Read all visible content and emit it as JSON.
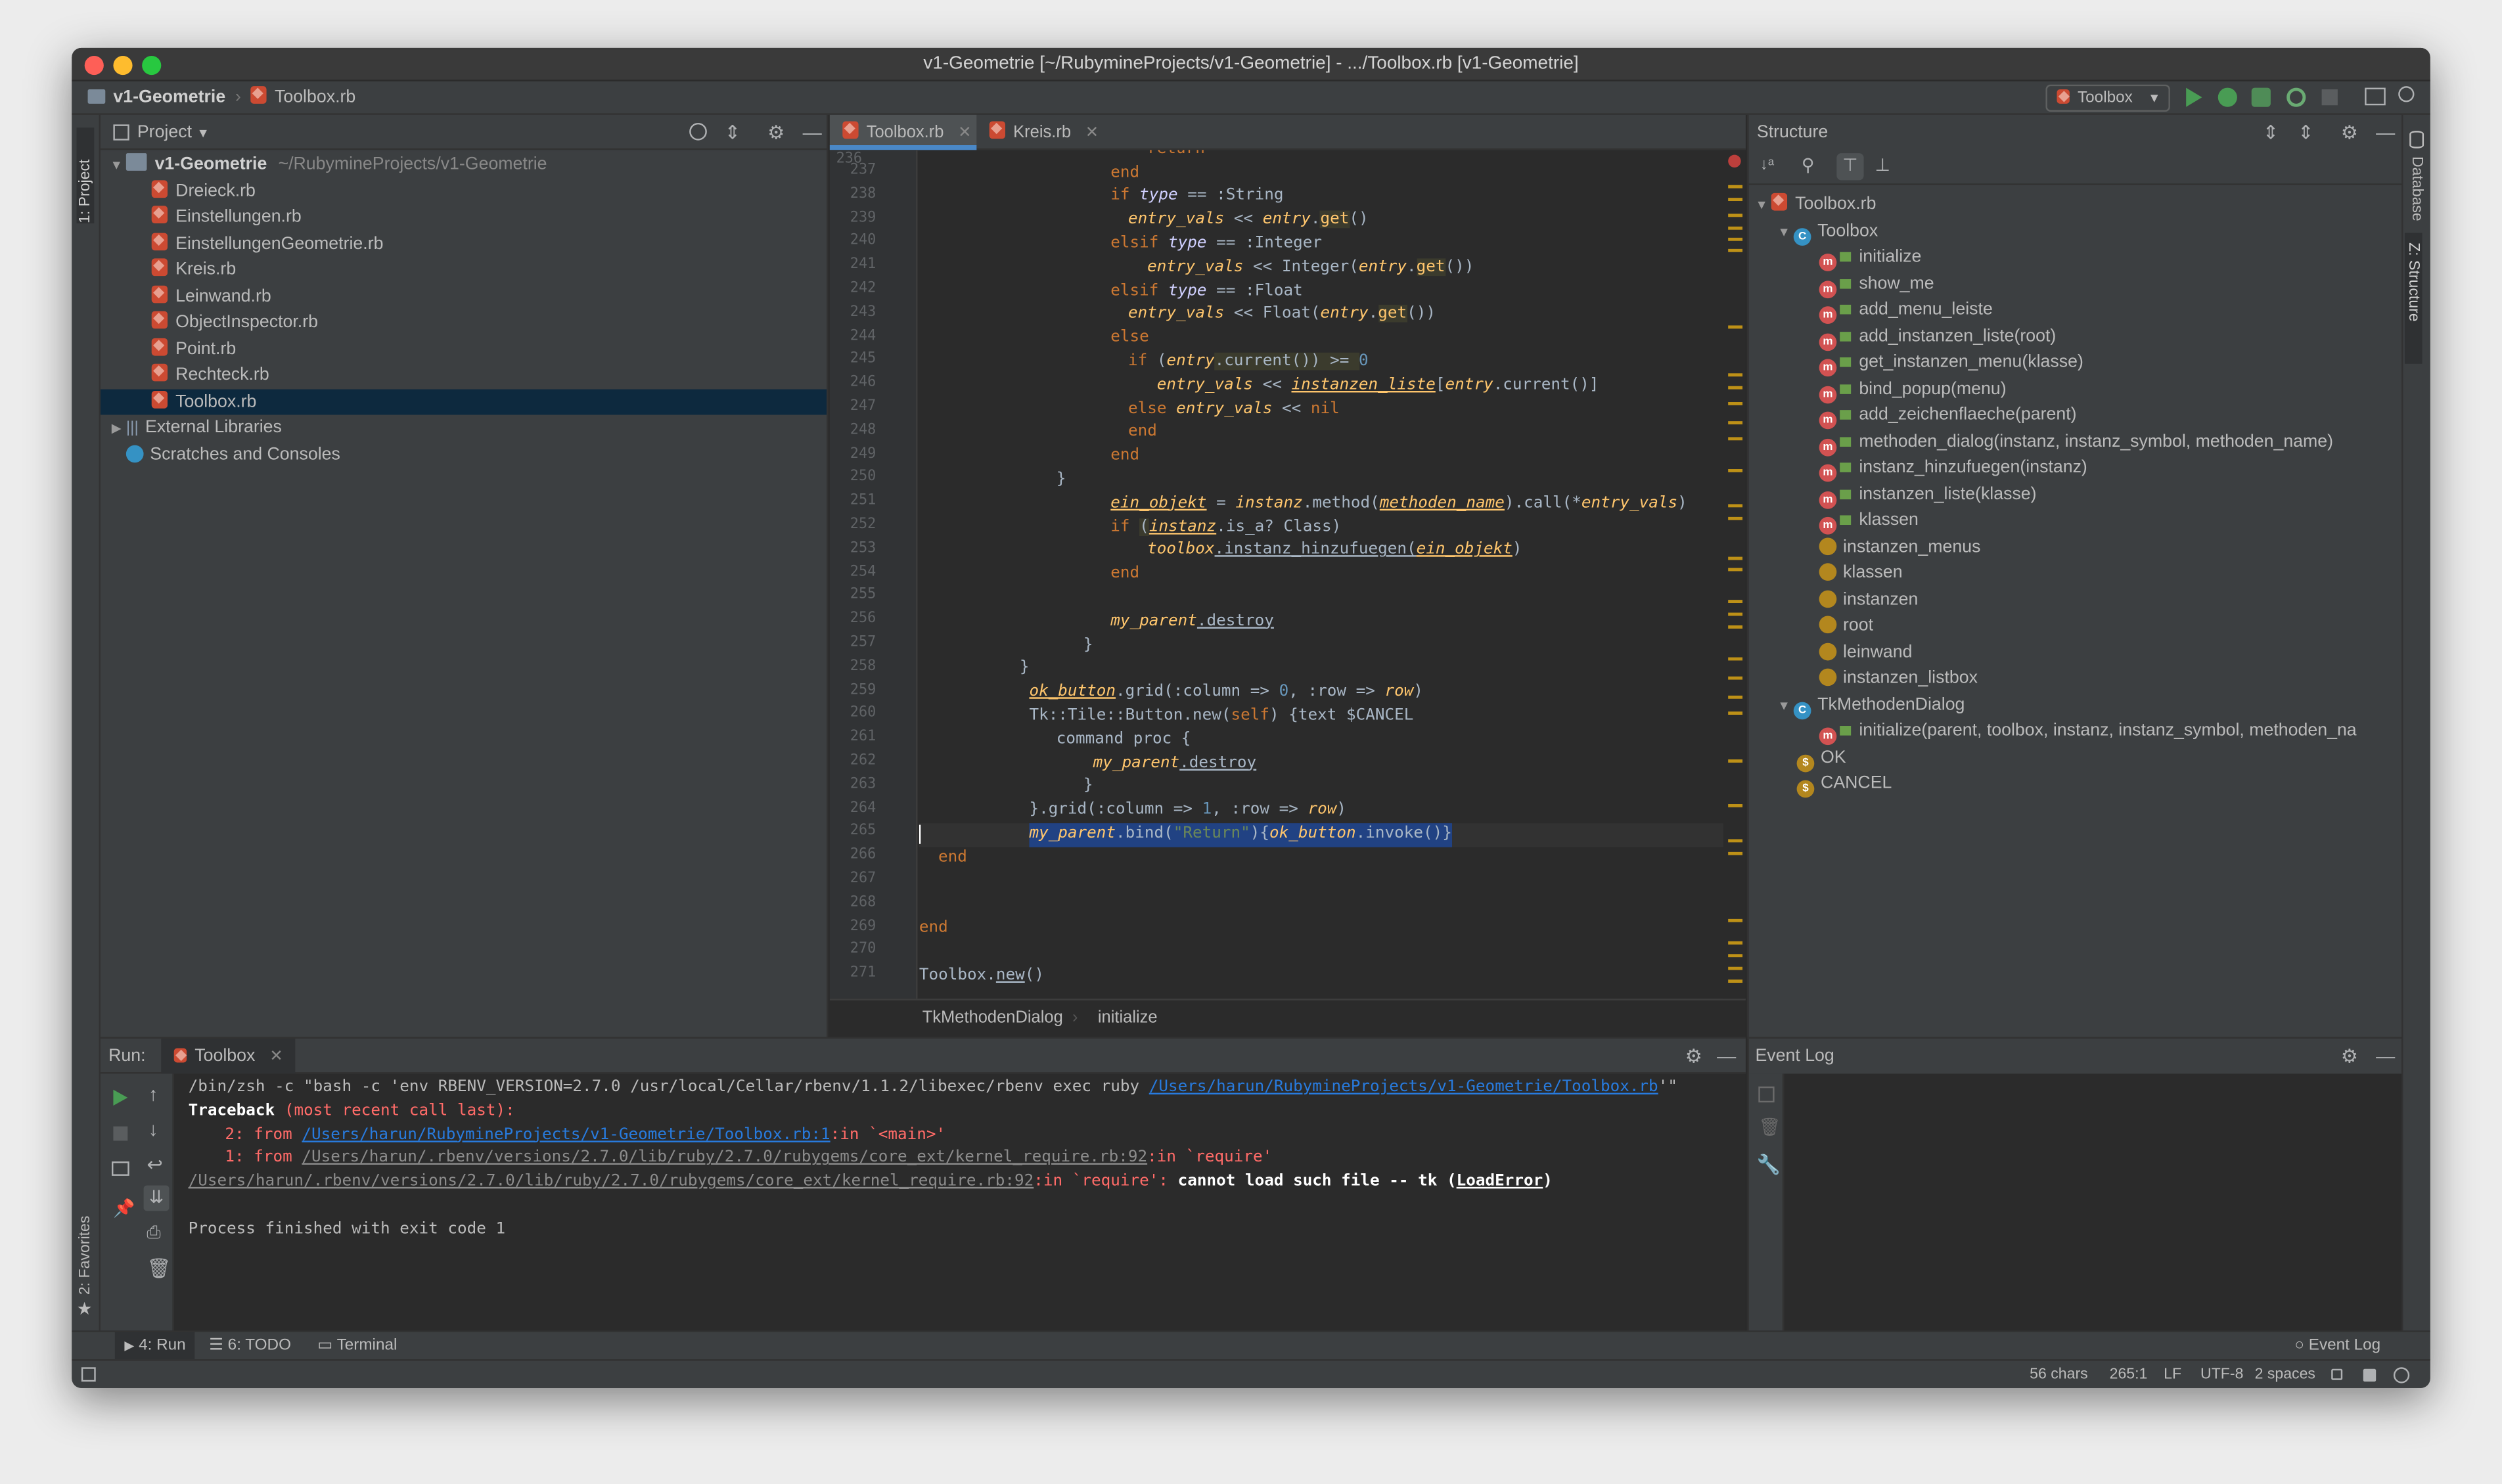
{
  "window": {
    "title": "v1-Geometrie [~/RubymineProjects/v1-Geometrie] - .../Toolbox.rb [v1-Geometrie]"
  },
  "navbar": {
    "project": "v1-Geometrie",
    "file": "Toolbox.rb",
    "run_config": "Toolbox"
  },
  "left_strip": {
    "project_tab": "1: Project",
    "favorites_tab": "2: Favorites"
  },
  "right_strip": {
    "database_tab": "Database",
    "structure_tab": "Z: Structure"
  },
  "project_panel": {
    "title": "Project",
    "root_name": "v1-Geometrie",
    "root_path": "~/RubymineProjects/v1-Geometrie",
    "files": [
      "Dreieck.rb",
      "Einstellungen.rb",
      "EinstellungenGeometrie.rb",
      "Kreis.rb",
      "Leinwand.rb",
      "ObjectInspector.rb",
      "Point.rb",
      "Rechteck.rb",
      "Toolbox.rb"
    ],
    "external_libraries": "External Libraries",
    "scratches": "Scratches and Consoles"
  },
  "editor": {
    "tabs": [
      "Toolbox.rb",
      "Kreis.rb"
    ],
    "line_numbers": [
      "237",
      "238",
      "239",
      "240",
      "241",
      "242",
      "243",
      "244",
      "245",
      "246",
      "247",
      "248",
      "249",
      "250",
      "251",
      "252",
      "253",
      "254",
      "255",
      "256",
      "257",
      "258",
      "259",
      "260",
      "261",
      "262",
      "263",
      "264",
      "265",
      "266",
      "267",
      "268",
      "269",
      "270",
      "271"
    ],
    "breadcrumb": [
      "TkMethodenDialog",
      "initialize"
    ],
    "top_partial": "return",
    "code": {
      "l237": "end",
      "l238a": "if ",
      "l238b": "type",
      "l238c": " == :String",
      "l239a": "entry_vals",
      "l239b": " << ",
      "l239c": "entry",
      "l239d": ".",
      "l239e": "get",
      "l239f": "()",
      "l240a": "elsif ",
      "l240b": "type",
      "l240c": " == :Integer",
      "l241a": "entry_vals",
      "l241b": " << Integer(",
      "l241c": "entry",
      "l241d": ".",
      "l241e": "get",
      "l241f": "())",
      "l242a": "elsif ",
      "l242b": "type",
      "l242c": " == :Float",
      "l243a": "entry_vals",
      "l243b": " << Float(",
      "l243c": "entry",
      "l243d": ".",
      "l243e": "get",
      "l243f": "())",
      "l244": "else",
      "l245a": "if ",
      "l245b": "(",
      "l245c": "entry",
      "l245d": ".current()) >= ",
      "l245e": "0",
      "l246a": "entry_vals",
      "l246b": " << ",
      "l246c": "instanzen_liste",
      "l246d": "[",
      "l246e": "entry",
      "l246f": ".current()]",
      "l247a": "else ",
      "l247b": "entry_vals",
      "l247c": " << ",
      "l247d": "nil",
      "l248": "end",
      "l249": "end",
      "l250": "}",
      "l251a": "ein_objekt",
      "l251b": " = ",
      "l251c": "instanz",
      "l251d": ".method(",
      "l251e": "methoden_name",
      "l251f": ").call(*",
      "l251g": "entry_vals",
      "l251h": ")",
      "l252a": "if ",
      "l252b": "(",
      "l252c": "instanz",
      "l252d": ".is_a? Class)",
      "l253a": "toolbox",
      "l253b": ".instanz_hinzufuegen(",
      "l253c": "ein_objekt",
      "l253d": ")",
      "l254": "end",
      "l256a": "my_parent",
      "l256b": ".destroy",
      "l257": "}",
      "l258": "}",
      "l259a": "ok_button",
      "l259b": ".grid(:column => ",
      "l259c": "0",
      "l259d": ", :row => ",
      "l259e": "row",
      "l259f": ")",
      "l260a": "Tk::Tile::Button.new(",
      "l260b": "self",
      "l260c": ") {text $CANCEL",
      "l261": "command proc {",
      "l262a": "my_parent",
      "l262b": ".destroy",
      "l263": "}",
      "l264a": "}.grid(:column => ",
      "l264b": "1",
      "l264c": ", :row => ",
      "l264d": "row",
      "l264e": ")",
      "l265a": "my_parent",
      "l265b": ".bind(",
      "l265c": "\"Return\"",
      "l265d": "){",
      "l265e": "ok_button",
      "l265f": ".invoke()}",
      "l266": "end",
      "l269": "end",
      "l271a": "Toolbox.",
      "l271b": "new",
      "l271c": "()"
    }
  },
  "structure_panel": {
    "title": "Structure",
    "file": "Toolbox.rb",
    "class1": "Toolbox",
    "class1_methods": [
      "initialize",
      "show_me",
      "add_menu_leiste",
      "add_instanzen_liste(root)",
      "get_instanzen_menu(klasse)",
      "bind_popup(menu)",
      "add_zeichenflaeche(parent)",
      "methoden_dialog(instanz, instanz_symbol, methoden_name)",
      "instanz_hinzufuegen(instanz)",
      "instanzen_liste(klasse)",
      "klassen"
    ],
    "class1_fields": [
      "instanzen_menus",
      "klassen",
      "instanzen",
      "root",
      "leinwand",
      "instanzen_listbox"
    ],
    "class2": "TkMethodenDialog",
    "class2_methods": [
      "initialize(parent, toolbox, instanz, instanz_symbol, methoden_na"
    ],
    "constants": [
      "OK",
      "CANCEL"
    ]
  },
  "run_panel": {
    "label": "Run:",
    "tab": "Toolbox",
    "console": {
      "cmd_a": "/bin/zsh -c \"bash -c 'env RBENV_VERSION=2.7.0 /usr/local/Cellar/rbenv/1.1.2/libexec/rbenv exec ruby ",
      "cmd_link": "/Users/harun/RubymineProjects/v1-Geometrie/Toolbox.rb",
      "cmd_b": "'\"",
      "tb_a": "Traceback ",
      "tb_b": "(most recent call last):",
      "f2_a": "2: from ",
      "f2_link": "/Users/harun/RubymineProjects/v1-Geometrie/Toolbox.rb:1",
      "f2_b": ":in `<main>'",
      "f1_a": "1: from ",
      "f1_link": "/Users/harun/.rbenv/versions/2.7.0/lib/ruby/2.7.0/rubygems/core_ext/kernel_require.rb:92",
      "f1_b": ":in `require'",
      "err_link": "/Users/harun/.rbenv/versions/2.7.0/lib/ruby/2.7.0/rubygems/core_ext/kernel_require.rb:92",
      "err_b": ":in `require': ",
      "err_c": "cannot load such file -- tk (",
      "err_d": "LoadError",
      "err_e": ")",
      "exit": "Process finished with exit code 1"
    }
  },
  "event_log": {
    "title": "Event Log"
  },
  "bottom_tabs": {
    "run": "4: Run",
    "todo": "6: TODO",
    "terminal": "Terminal",
    "event_log": "Event Log"
  },
  "status": {
    "chars": "56 chars",
    "position": "265:1",
    "line_sep": "LF",
    "encoding": "UTF-8",
    "indent": "2 spaces"
  },
  "colors": {
    "accent": "#4a88c7",
    "keyword": "#cc7832",
    "string": "#6a8759",
    "number": "#6897bb",
    "error": "#ff6b68",
    "link": "#287bde"
  }
}
